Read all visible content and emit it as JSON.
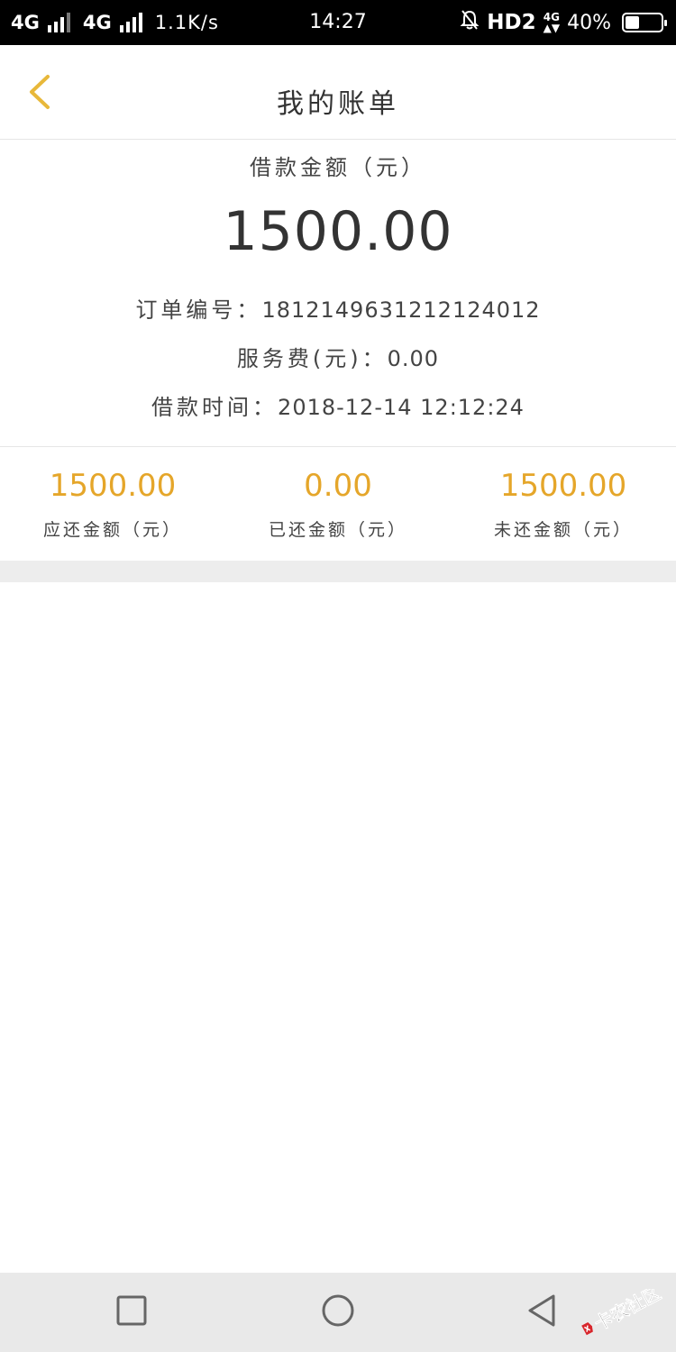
{
  "status_bar": {
    "network1": "4G",
    "network2": "4G",
    "speed": "1.1K/s",
    "time": "14:27",
    "hd_label": "HD2",
    "small_network": "4G",
    "battery": "40%",
    "battery_level_percent": 40
  },
  "header": {
    "title": "我的账单",
    "back_icon": "chevron-left-icon",
    "accent_color": "#e8b83a"
  },
  "loan": {
    "amount_label": "借款金额（元）",
    "amount": "1500.00",
    "order_no_label": "订单编号：",
    "order_no": "1812149631212124012",
    "fee_label": "服务费(元)：",
    "fee": "0.00",
    "time_label": "借款时间：",
    "time": "2018-12-14 12:12:24"
  },
  "stats": [
    {
      "value": "1500.00",
      "label": "应还金额（元）"
    },
    {
      "value": "0.00",
      "label": "已还金额（元）"
    },
    {
      "value": "1500.00",
      "label": "未还金额（元）"
    }
  ],
  "stat_color": "#e5a62a",
  "nav": {
    "recent_icon": "square-icon",
    "home_icon": "circle-icon",
    "back_icon": "triangle-back-icon"
  },
  "watermark": {
    "text": "卡农社区"
  }
}
